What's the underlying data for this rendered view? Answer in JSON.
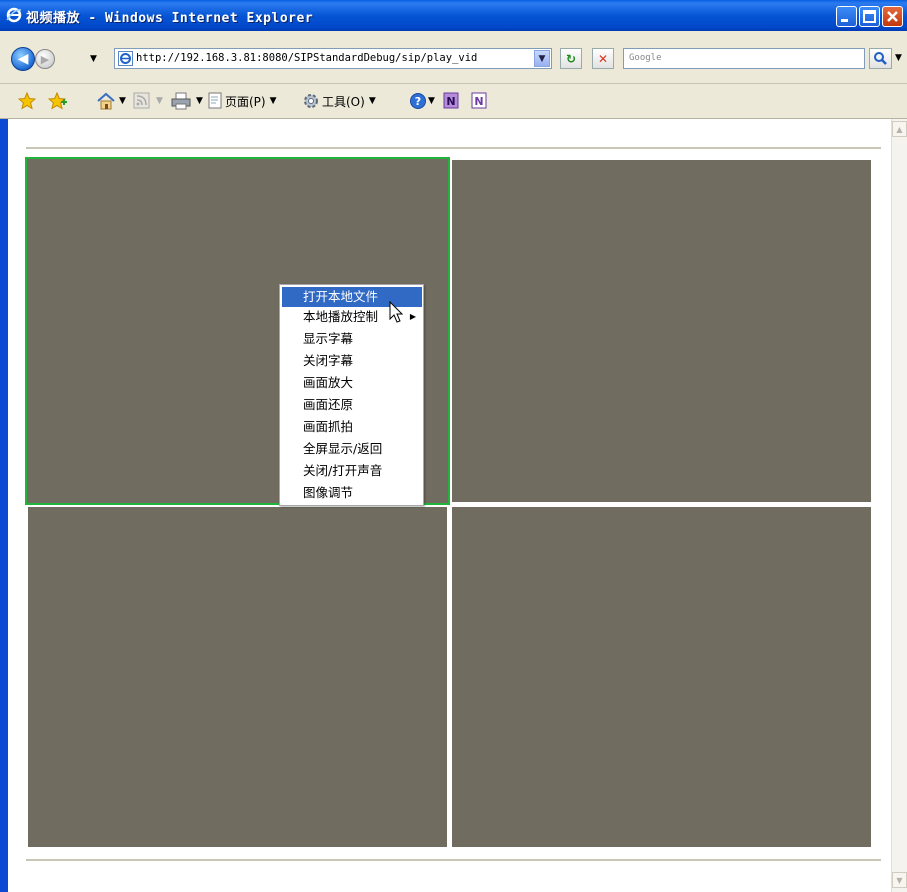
{
  "window": {
    "title": "视频播放 - Windows Internet Explorer",
    "controls": {
      "minimize_icon": "minimize-icon",
      "maximize_icon": "maximize-icon",
      "close_icon": "close-icon"
    }
  },
  "navigation": {
    "address": "http://192.168.3.81:8080/SIPStandardDebug/sip/play_vid",
    "search_placeholder": "Google"
  },
  "command_bar": {
    "page_label": "页面(P)",
    "tools_label": "工具(O)"
  },
  "context_menu": {
    "items": [
      {
        "label": "打开本地文件",
        "highlighted": true
      },
      {
        "label": "本地播放控制",
        "submenu": true
      },
      {
        "label": "显示字幕"
      },
      {
        "label": "关闭字幕"
      },
      {
        "label": "画面放大"
      },
      {
        "label": "画面还原"
      },
      {
        "label": "画面抓拍"
      },
      {
        "label": "全屏显示/返回"
      },
      {
        "label": "关闭/打开声音"
      },
      {
        "label": "图像调节"
      }
    ]
  },
  "colors": {
    "video_panel": "#706d60",
    "selected_border": "#22b33a",
    "menu_highlight": "#316ac5"
  }
}
